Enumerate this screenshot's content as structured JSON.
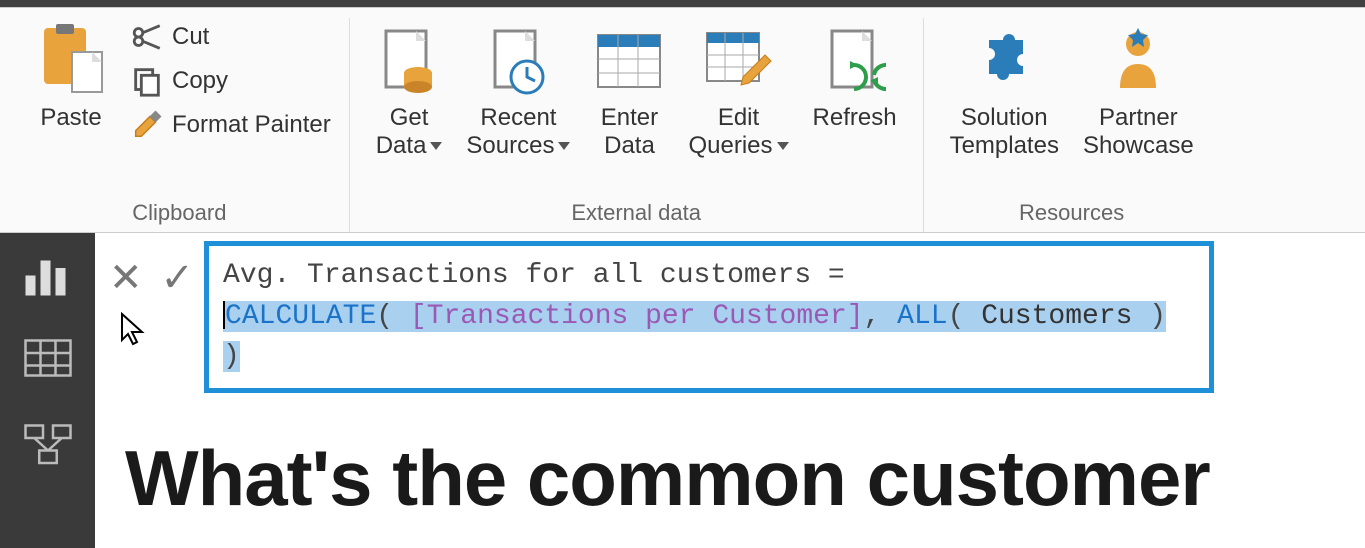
{
  "ribbon": {
    "clipboard": {
      "paste": "Paste",
      "cut": "Cut",
      "copy": "Copy",
      "format_painter": "Format Painter",
      "group_label": "Clipboard"
    },
    "external_data": {
      "get_data": "Get\nData",
      "recent_sources": "Recent\nSources",
      "enter_data": "Enter\nData",
      "edit_queries": "Edit\nQueries",
      "refresh": "Refresh",
      "group_label": "External data"
    },
    "resources": {
      "solution_templates": "Solution\nTemplates",
      "partner_showcase": "Partner\nShowcase",
      "group_label": "Resources"
    }
  },
  "formula": {
    "measure_name": "Avg. Transactions for all customers = ",
    "calc": "CALCULATE",
    "open": "( ",
    "measure_ref": "[Transactions per Customer]",
    "comma": ", ",
    "all_fn": "ALL",
    "open2": "( ",
    "table_ref": "Customers",
    "close2": " ) )"
  },
  "report": {
    "heading": "What's the common customer"
  },
  "colors": {
    "accent": "#1e90d8"
  }
}
